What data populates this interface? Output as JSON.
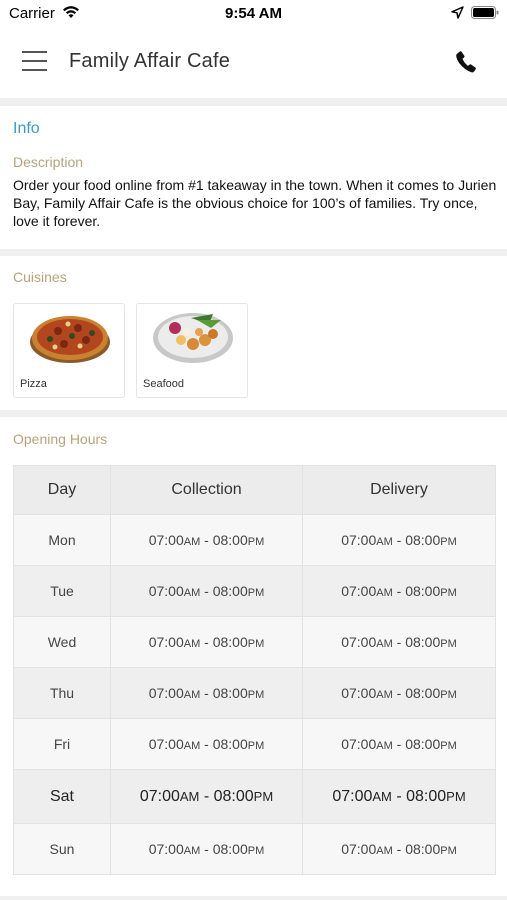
{
  "status_bar": {
    "carrier": "Carrier",
    "time": "9:54 AM",
    "icons": [
      "wifi-icon",
      "location-arrow-icon",
      "battery-icon"
    ]
  },
  "header": {
    "title": "Family Affair Cafe",
    "menu_icon": "hamburger-menu-icon",
    "call_icon": "phone-icon"
  },
  "info": {
    "title": "Info",
    "description_label": "Description",
    "description": "Order your food online from #1 takeaway in the town. When it comes to Jurien Bay, Family Affair Cafe is the obvious choice for 100’s of families. Try once, love it forever."
  },
  "cuisines": {
    "label": "Cuisines",
    "items": [
      {
        "name": "Pizza",
        "image": "pizza-image"
      },
      {
        "name": "Seafood",
        "image": "seafood-image"
      }
    ]
  },
  "opening_hours": {
    "label": "Opening Hours",
    "columns": [
      "Day",
      "Collection",
      "Delivery"
    ],
    "rows": [
      {
        "day": "Mon",
        "collection": {
          "open": "07:00",
          "open_ampm": "AM",
          "sep": " - ",
          "close": "08:00",
          "close_ampm": "PM"
        },
        "delivery": {
          "open": "07:00",
          "open_ampm": "AM",
          "sep": " - ",
          "close": "08:00",
          "close_ampm": "PM"
        }
      },
      {
        "day": "Tue",
        "collection": {
          "open": "07:00",
          "open_ampm": "AM",
          "sep": " - ",
          "close": "08:00",
          "close_ampm": "PM"
        },
        "delivery": {
          "open": "07:00",
          "open_ampm": "AM",
          "sep": " - ",
          "close": "08:00",
          "close_ampm": "PM"
        }
      },
      {
        "day": "Wed",
        "collection": {
          "open": "07:00",
          "open_ampm": "AM",
          "sep": " - ",
          "close": "08:00",
          "close_ampm": "PM"
        },
        "delivery": {
          "open": "07:00",
          "open_ampm": "AM",
          "sep": " - ",
          "close": "08:00",
          "close_ampm": "PM"
        }
      },
      {
        "day": "Thu",
        "collection": {
          "open": "07:00",
          "open_ampm": "AM",
          "sep": " - ",
          "close": "08:00",
          "close_ampm": "PM"
        },
        "delivery": {
          "open": "07:00",
          "open_ampm": "AM",
          "sep": " - ",
          "close": "08:00",
          "close_ampm": "PM"
        }
      },
      {
        "day": "Fri",
        "collection": {
          "open": "07:00",
          "open_ampm": "AM",
          "sep": " - ",
          "close": "08:00",
          "close_ampm": "PM"
        },
        "delivery": {
          "open": "07:00",
          "open_ampm": "AM",
          "sep": " - ",
          "close": "08:00",
          "close_ampm": "PM"
        }
      },
      {
        "day": "Sat",
        "collection": {
          "open": "07:00",
          "open_ampm": "AM",
          "sep": " - ",
          "close": "08:00",
          "close_ampm": "PM"
        },
        "delivery": {
          "open": "07:00",
          "open_ampm": "AM",
          "sep": " - ",
          "close": "08:00",
          "close_ampm": "PM"
        }
      },
      {
        "day": "Sun",
        "collection": {
          "open": "07:00",
          "open_ampm": "AM",
          "sep": " - ",
          "close": "08:00",
          "close_ampm": "PM"
        },
        "delivery": {
          "open": "07:00",
          "open_ampm": "AM",
          "sep": " - ",
          "close": "08:00",
          "close_ampm": "PM"
        }
      }
    ],
    "highlighted_day": "Sat"
  },
  "colors": {
    "info_title": "#3a9bc9",
    "section_label": "#b7a37e"
  }
}
